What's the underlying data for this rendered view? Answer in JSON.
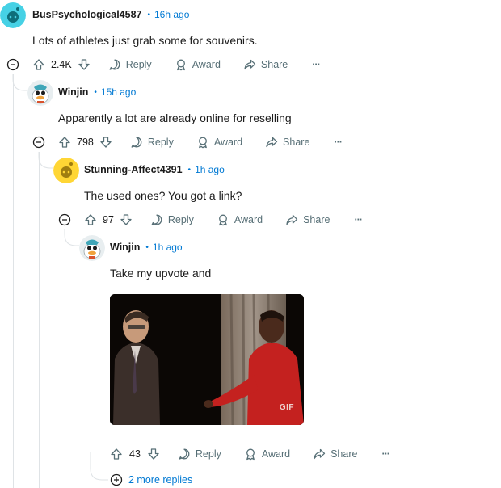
{
  "comments": [
    {
      "username": "BusPsychological4587",
      "time": "16h ago",
      "text": "Lots of athletes just grab some for souvenirs.",
      "votes": "2.4K",
      "avatar": "snoo-teal-icon"
    },
    {
      "username": "Winjin",
      "time": "15h ago",
      "text": "Apparently a lot are already online for reselling",
      "votes": "798",
      "avatar": "duck-avatar-icon"
    },
    {
      "username": "Stunning-Affect4391",
      "time": "1h ago",
      "text": "The used ones? You got a link?",
      "votes": "97",
      "avatar": "snoo-yellow-icon"
    },
    {
      "username": "Winjin",
      "time": "1h ago",
      "text": "Take my upvote and",
      "votes": "43",
      "avatar": "duck-avatar-icon",
      "media_label": "GIF"
    }
  ],
  "actions": {
    "reply": "Reply",
    "award": "Award",
    "share": "Share",
    "more": "···"
  },
  "separator": "•",
  "more_replies": "2 more replies",
  "colors": {
    "accent": "#0079d3",
    "muted": "#576f76",
    "thread_line": "#dfe3e6"
  }
}
